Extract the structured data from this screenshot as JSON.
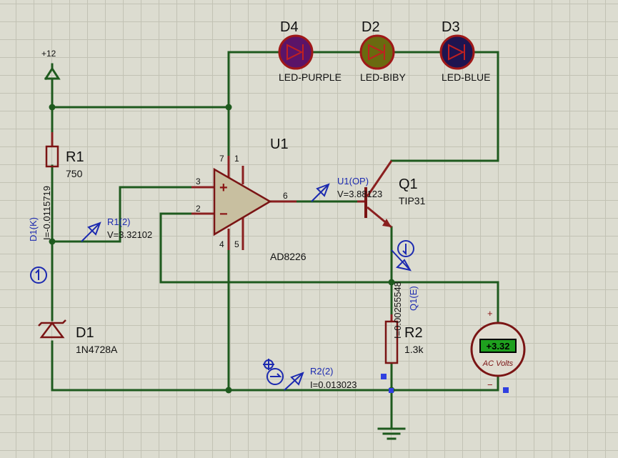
{
  "power": {
    "label": "+12"
  },
  "components": {
    "r1": {
      "ref": "R1",
      "value": "750"
    },
    "r2": {
      "ref": "R2",
      "value": "1.3k"
    },
    "d1": {
      "ref": "D1",
      "value": "1N4728A"
    },
    "d2": {
      "ref": "D2",
      "value": "LED-BIBY"
    },
    "d3": {
      "ref": "D3",
      "value": "LED-BLUE"
    },
    "d4": {
      "ref": "D4",
      "value": "LED-PURPLE"
    },
    "u1": {
      "ref": "U1",
      "value": "AD8226",
      "pins": [
        "7",
        "1",
        "3",
        "2",
        "6",
        "4",
        "5"
      ],
      "plus": "+",
      "minus": "−"
    },
    "q1": {
      "ref": "Q1",
      "value": "TIP31"
    }
  },
  "probes": {
    "r1_2": {
      "label": "R1(2)",
      "reading": "V=3.32102"
    },
    "u1_op": {
      "label": "U1(OP)",
      "reading": "V=3.88123"
    },
    "r2_2": {
      "label": "R2(2)",
      "reading": "I=0.013023"
    },
    "d1_k": {
      "label": "D1(K)",
      "reading": "I=-0.0115719"
    },
    "q1_e": {
      "label": "Q1(E)",
      "reading": "I=0.00255548"
    }
  },
  "voltmeter": {
    "display": "+3.32",
    "label": "AC Volts",
    "plus": "+",
    "minus": "−"
  },
  "colors": {
    "wire": "#1e5a1e",
    "component": "#7a1414",
    "probe": "#1c2ab0",
    "led_purple": "#5a1468",
    "led_biby": "#6a6a10",
    "led_blue": "#1e1450",
    "meter_display": "#1ea01e"
  }
}
